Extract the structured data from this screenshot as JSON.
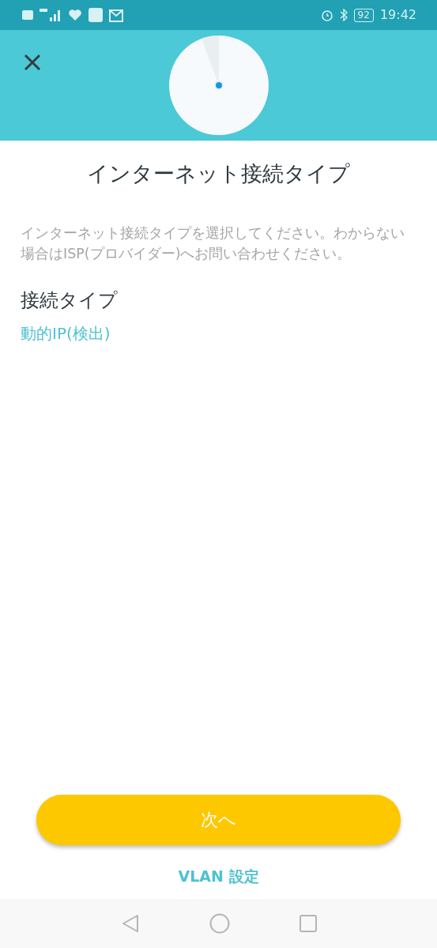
{
  "status_bar": {
    "battery": "92",
    "time": "19:42"
  },
  "title": "インターネット接続タイプ",
  "description": "インターネット接続タイプを選択してください。わからない場合はISP(プロバイダー)へお問い合わせください。",
  "section_heading": "接続タイプ",
  "connection_type": "動的IP(検出)",
  "next_button": "次へ",
  "vlan_link": "VLAN 設定"
}
